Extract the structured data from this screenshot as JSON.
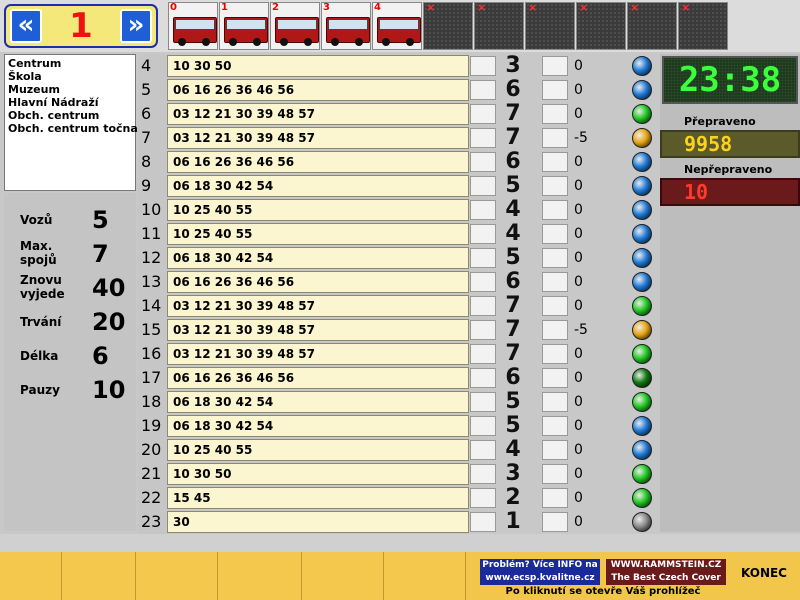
{
  "nav": {
    "prev_label": "«",
    "next_label": "»",
    "line_number": "1"
  },
  "thumbnails": [
    {
      "index": "0",
      "type": "bus"
    },
    {
      "index": "1",
      "type": "bus"
    },
    {
      "index": "2",
      "type": "bus"
    },
    {
      "index": "3",
      "type": "bus"
    },
    {
      "index": "4",
      "type": "bus"
    },
    {
      "index": "×",
      "type": "empty"
    },
    {
      "index": "×",
      "type": "empty"
    },
    {
      "index": "×",
      "type": "empty"
    },
    {
      "index": "×",
      "type": "empty"
    },
    {
      "index": "×",
      "type": "empty"
    },
    {
      "index": "×",
      "type": "empty"
    }
  ],
  "stops": [
    "Centrum",
    "Škola",
    "Muzeum",
    "Hlavní Nádraží",
    "Obch. centrum",
    "Obch. centrum točna"
  ],
  "stats": [
    {
      "label": "Vozů",
      "value": "5"
    },
    {
      "label": "Max.\nspojů",
      "value": "7"
    },
    {
      "label": "Znovu\nvyjede",
      "value": "40"
    },
    {
      "label": "Trvání",
      "value": "20"
    },
    {
      "label": "Délka",
      "value": "6"
    },
    {
      "label": "Pauzy",
      "value": "10"
    }
  ],
  "rows": [
    {
      "hour": "4",
      "minutes": "10 30 50",
      "count": "3",
      "offset": "0",
      "dot": "blue"
    },
    {
      "hour": "5",
      "minutes": "06 16 26 36 46 56",
      "count": "6",
      "offset": "0",
      "dot": "blue"
    },
    {
      "hour": "6",
      "minutes": "03 12 21 30 39 48 57",
      "count": "7",
      "offset": "0",
      "dot": "green"
    },
    {
      "hour": "7",
      "minutes": "03 12 21 30 39 48 57",
      "count": "7",
      "offset": "-5",
      "dot": "orange"
    },
    {
      "hour": "8",
      "minutes": "06 16 26 36 46 56",
      "count": "6",
      "offset": "0",
      "dot": "blue"
    },
    {
      "hour": "9",
      "minutes": "06 18 30 42 54",
      "count": "5",
      "offset": "0",
      "dot": "blue"
    },
    {
      "hour": "10",
      "minutes": "10 25 40 55",
      "count": "4",
      "offset": "0",
      "dot": "blue"
    },
    {
      "hour": "11",
      "minutes": "10 25 40 55",
      "count": "4",
      "offset": "0",
      "dot": "blue"
    },
    {
      "hour": "12",
      "minutes": "06 18 30 42 54",
      "count": "5",
      "offset": "0",
      "dot": "blue"
    },
    {
      "hour": "13",
      "minutes": "06 16 26 36 46 56",
      "count": "6",
      "offset": "0",
      "dot": "blue"
    },
    {
      "hour": "14",
      "minutes": "03 12 21 30 39 48 57",
      "count": "7",
      "offset": "0",
      "dot": "green"
    },
    {
      "hour": "15",
      "minutes": "03 12 21 30 39 48 57",
      "count": "7",
      "offset": "-5",
      "dot": "orange"
    },
    {
      "hour": "16",
      "minutes": "03 12 21 30 39 48 57",
      "count": "7",
      "offset": "0",
      "dot": "green"
    },
    {
      "hour": "17",
      "minutes": "06 16 26 36 46 56",
      "count": "6",
      "offset": "0",
      "dot": "darkgreen"
    },
    {
      "hour": "18",
      "minutes": "06 18 30 42 54",
      "count": "5",
      "offset": "0",
      "dot": "green"
    },
    {
      "hour": "19",
      "minutes": "06 18 30 42 54",
      "count": "5",
      "offset": "0",
      "dot": "blue"
    },
    {
      "hour": "20",
      "minutes": "10 25 40 55",
      "count": "4",
      "offset": "0",
      "dot": "blue"
    },
    {
      "hour": "21",
      "minutes": "10 30 50",
      "count": "3",
      "offset": "0",
      "dot": "green"
    },
    {
      "hour": "22",
      "minutes": "15 45",
      "count": "2",
      "offset": "0",
      "dot": "green"
    },
    {
      "hour": "23",
      "minutes": "30",
      "count": "1",
      "offset": "0",
      "dot": "gray"
    }
  ],
  "dot_colors": {
    "blue": "#1e7ad8",
    "green": "#1fc81f",
    "orange": "#e8a412",
    "darkgreen": "#0f7a0f",
    "gray": "#8a8a8a"
  },
  "clock": "23:38",
  "transported": {
    "label": "Přepraveno",
    "value": "9958"
  },
  "not_transported": {
    "label": "Nepřepraveno",
    "value": "10"
  },
  "bottom": {
    "info_problem": "Problém? Více INFO na",
    "info_url": "www.ecsp.kvalitne.cz",
    "promo_line1": "WWW.RAMMSTEIN.CZ",
    "promo_line2": "The Best Czech Cover",
    "note": "Po kliknutí se otevře Váš prohlížeč",
    "exit_label": "KONEC"
  }
}
